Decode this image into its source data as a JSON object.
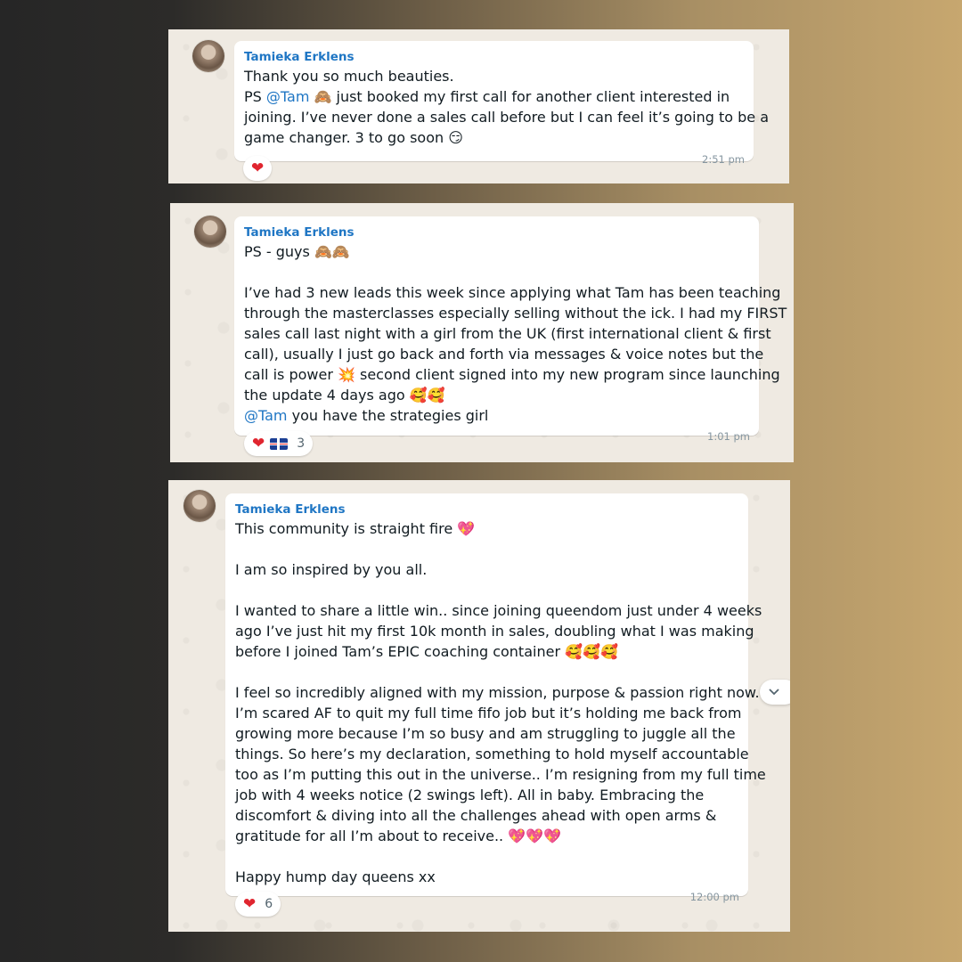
{
  "messages": [
    {
      "sender": "Tamieka Erklens",
      "lines": [
        "Thank you so much beauties.",
        "PS ",
        "joining. I’ve never done a sales call before but I can feel it’s going to be a",
        "game changer. 3 to go soon 😏"
      ],
      "mention": "@Tam",
      "line2_rest": " 🙈 just booked my first call for another client interested in",
      "time": "2:51 pm",
      "reaction_emoji": "❤",
      "reaction_count": ""
    },
    {
      "sender": "Tamieka Erklens",
      "lines": [
        "PS - guys 🙈🙈",
        "",
        "I’ve had 3 new leads this week since applying what Tam has been teaching",
        "through the masterclasses especially selling without the ick. I had my FIRST",
        "sales call last night with a girl from the UK (first international client & first",
        "call), usually I just go back and forth via messages & voice notes but the",
        "call is power 💥 second client signed into my new program since launching",
        "the update 4 days ago 🥰🥰"
      ],
      "mention": "@Tam",
      "last_line_rest": " you have the strategies girl",
      "time": "1:01 pm",
      "reaction_emoji": "❤",
      "reaction_flag": "uk-flag",
      "reaction_count": "3"
    },
    {
      "sender": "Tamieka Erklens",
      "lines": [
        "This community is straight fire 💖",
        "",
        "I am so inspired by you all.",
        "",
        "I wanted to share a little win.. since joining queendom just under 4 weeks",
        "ago I’ve just hit my first 10k month in sales, doubling what I was making",
        "before I joined Tam’s EPIC coaching container 🥰🥰🥰",
        "",
        "I feel so incredibly aligned with my mission, purpose & passion right now.",
        "I’m scared AF to quit my full time fifo job but it’s holding me back from",
        "growing more because I’m so busy and am struggling to juggle all the",
        "things. So here’s my declaration, something to hold myself accountable",
        "too as I’m putting this out in the universe.. I’m resigning from my full time",
        "job with 4 weeks notice (2 swings left). All in baby. Embracing the",
        "discomfort & diving into all the challenges ahead with open arms &",
        "gratitude for all I’m about to receive.. 💖💖💖",
        "",
        "Happy hump day queens xx"
      ],
      "time": "12:00 pm",
      "reaction_emoji": "❤",
      "reaction_count": "6",
      "scroll_icon": "chevron-down-icon"
    }
  ]
}
